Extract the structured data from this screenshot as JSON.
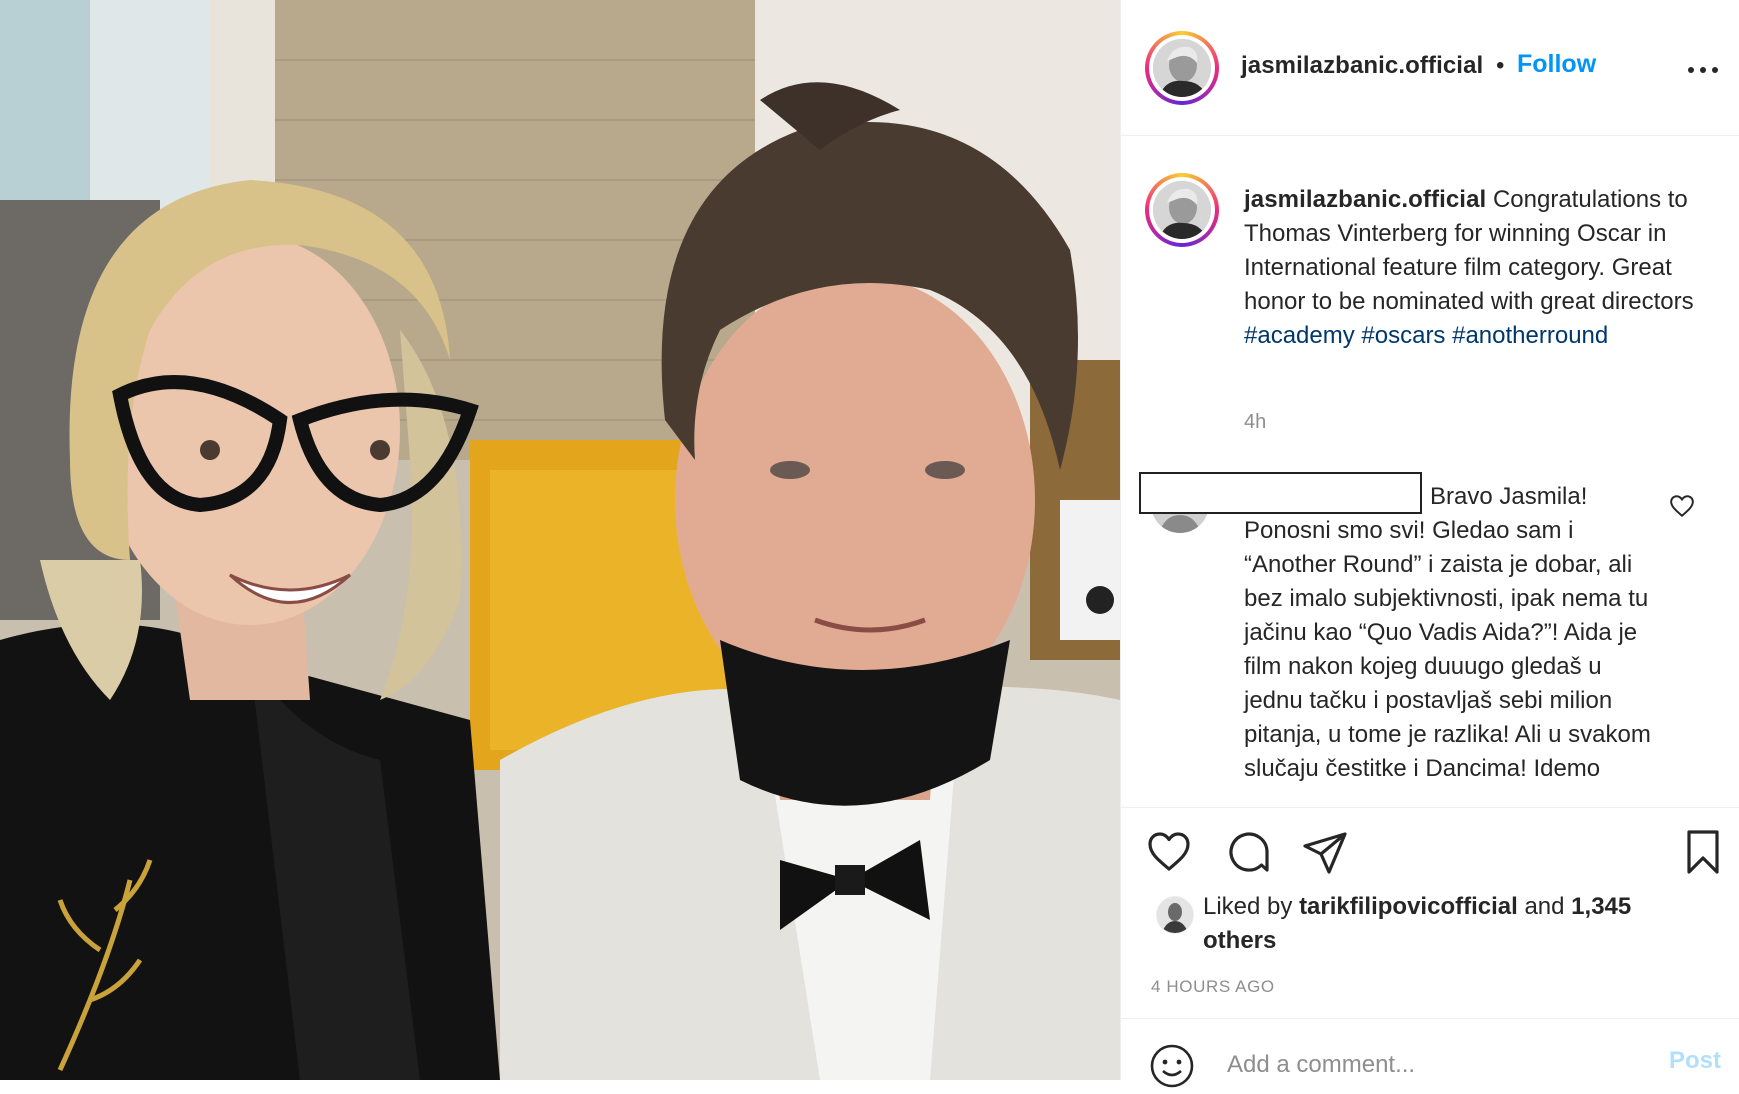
{
  "post": {
    "username": "jasmilazbanic.official",
    "separator": "•",
    "follow_label": "Follow",
    "more_icon": "more-horizontal-icon"
  },
  "caption": {
    "username": "jasmilazbanic.official",
    "text": "Congratulations to Thomas Vinterberg for winning Oscar in International feature film category. Great honor to be nominated with great directors",
    "hashtags": "#academy #oscars #anotherround",
    "time": "4h"
  },
  "comments": [
    {
      "text": "Bravo Jasmila! Ponosni smo svi! Gledao sam i “Another Round” i zaista je dobar, ali bez imalo subjektivnosti, ipak nema tu jačinu kao “Quo Vadis Aida?”! Aida je film nakon kojeg duuugo gledaš u jednu tačku i postavljaš sebi milion pitanja, u tome je razlika! Ali u svakom slučaju čestitke i Dancima! Idemo"
    }
  ],
  "actions": {
    "icons": [
      "heart-icon",
      "comment-icon",
      "share-icon",
      "bookmark-icon"
    ]
  },
  "likes": {
    "prefix": "Liked by",
    "user": "tarikfilipovicofficial",
    "conjunction": "and",
    "others": "1,345 others"
  },
  "timestamp": "4 HOURS AGO",
  "add_comment": {
    "placeholder": "Add a comment...",
    "post_label": "Post"
  },
  "colors": {
    "accent": "#0095f6",
    "hashtag": "#00376b",
    "muted": "#8e8e8e",
    "post_disabled": "#b2dffc"
  }
}
